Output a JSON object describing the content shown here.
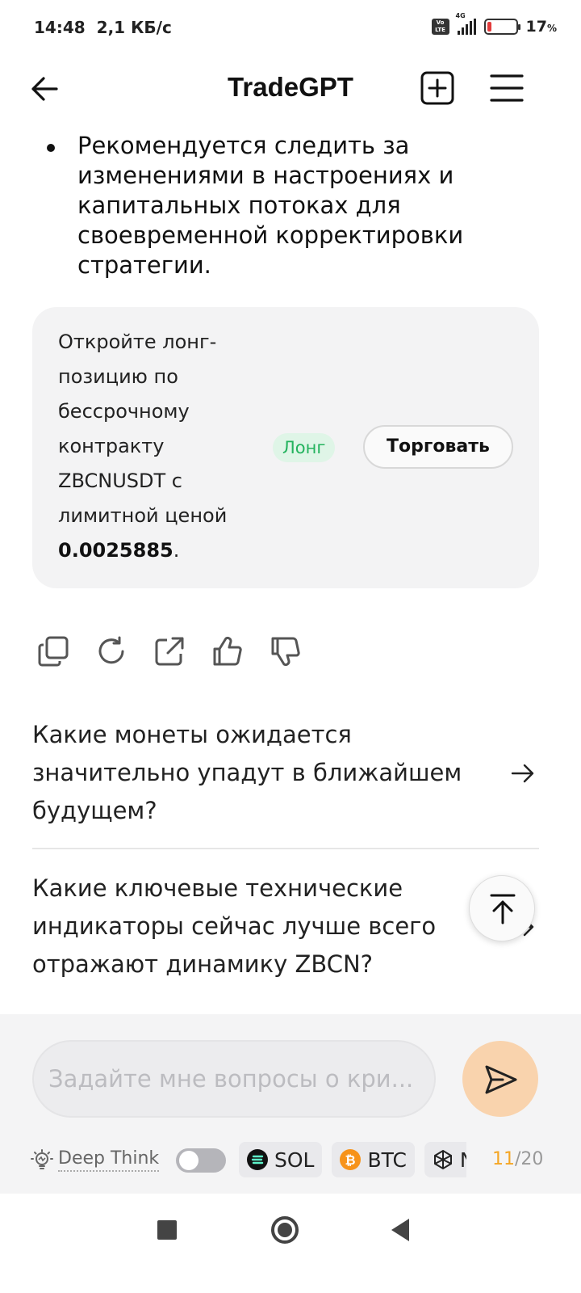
{
  "status_bar": {
    "time": "14:48",
    "speed": "2,1 КБ/с",
    "network": "4G",
    "volte": "Vo LTE",
    "battery": "17",
    "battery_unit": "%",
    "battery_level": 0.17
  },
  "header": {
    "title": "TradeGPT"
  },
  "message": {
    "bullet": "Рекомендуется следить за изменениями в настроениях и капитальных потоках для своевременной корректировки стратегии."
  },
  "trade_card": {
    "text": "Откройте лонг-позицию по бессрочному контракту ZBCNUSDT с лимитной ценой",
    "price": "0.0025885",
    "price_suffix": ".",
    "badge": "Лонг",
    "button": "Торговать",
    "colors": {
      "badge_bg": "#dff5e7",
      "badge_text": "#24b35e"
    }
  },
  "actions": [
    "copy-icon",
    "regenerate-icon",
    "share-icon",
    "thumbs-up-icon",
    "thumbs-down-icon"
  ],
  "suggestions": [
    "Какие монеты ожидается значительно упадут в ближайшем будущем?",
    "Какие ключевые технические индикаторы сейчас лучше всего отражают динамику ZBCN?"
  ],
  "composer": {
    "placeholder": "Задайте мне вопросы о кри...",
    "deep_think": "Deep Think",
    "chips": [
      "SOL",
      "BTC",
      "N"
    ],
    "counter_used": "11",
    "counter_total": "/20",
    "send_color": "#f9d3ad",
    "accent": "#f5a623"
  }
}
